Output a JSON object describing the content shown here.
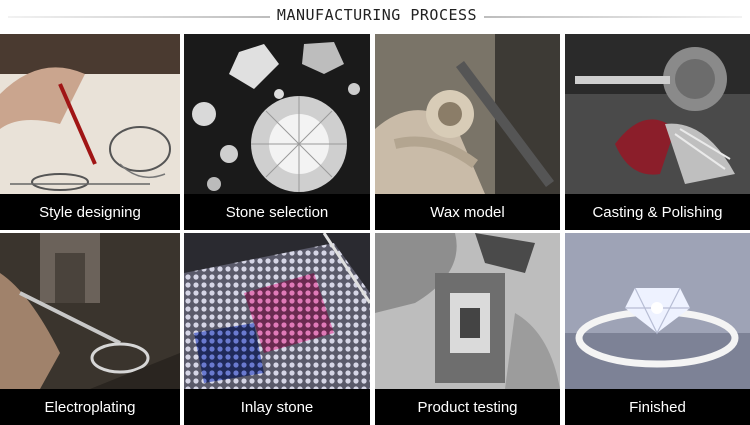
{
  "header": {
    "title": "MANUFACTURING PROCESS"
  },
  "steps": [
    {
      "label": "Style designing",
      "icon": "sketch-photo"
    },
    {
      "label": "Stone selection",
      "icon": "diamonds-photo"
    },
    {
      "label": "Wax model",
      "icon": "wax-carving-photo"
    },
    {
      "label": "Casting & Polishing",
      "icon": "polishing-photo"
    },
    {
      "label": "Electroplating",
      "icon": "electroplating-photo"
    },
    {
      "label": "Inlay stone",
      "icon": "inlay-photo"
    },
    {
      "label": "Product testing",
      "icon": "testing-photo"
    },
    {
      "label": "Finished",
      "icon": "ring-photo"
    }
  ]
}
